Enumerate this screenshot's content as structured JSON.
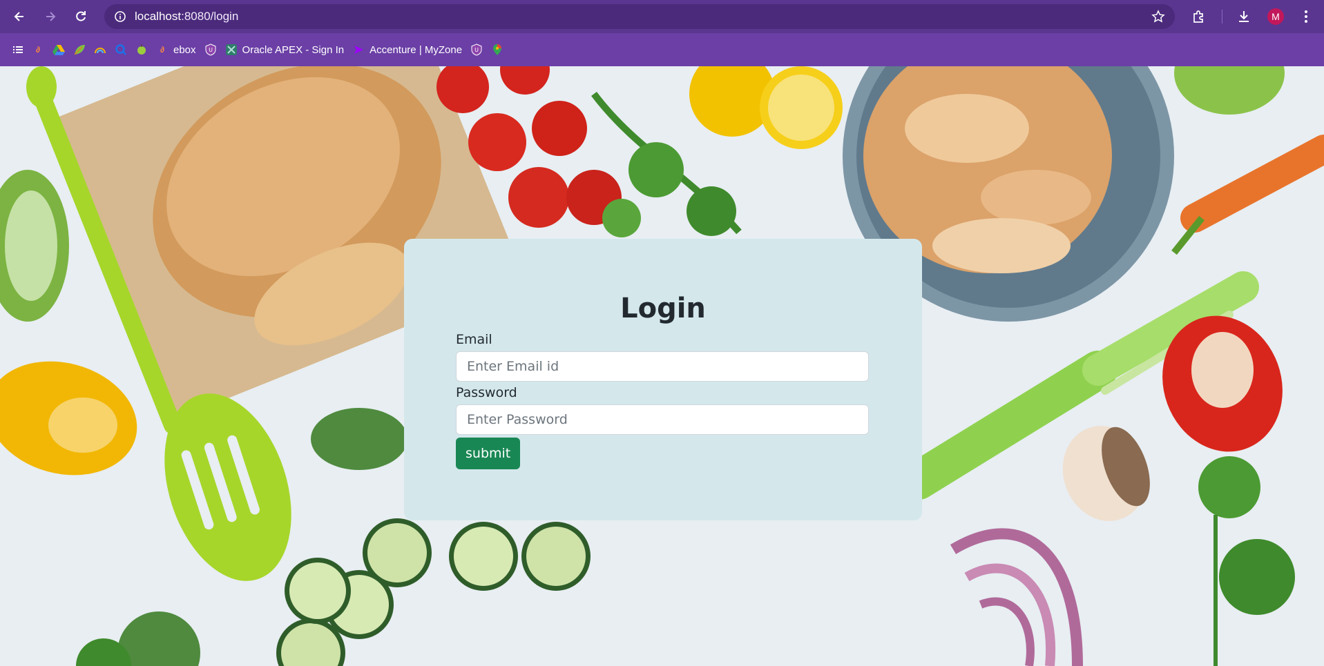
{
  "browser": {
    "url_host": "localhost",
    "url_path": ":8080/login",
    "avatar_letter": "M",
    "bookmarks": [
      {
        "icon": "apps-list-icon",
        "label": ""
      },
      {
        "icon": "link-icon",
        "label": ""
      },
      {
        "icon": "drive-icon",
        "label": ""
      },
      {
        "icon": "leaf-icon",
        "label": ""
      },
      {
        "icon": "rainbow-icon",
        "label": ""
      },
      {
        "icon": "search-icon",
        "label": ""
      },
      {
        "icon": "apple-icon",
        "label": ""
      },
      {
        "icon": "link-icon",
        "label": "ebox"
      },
      {
        "icon": "shield-icon",
        "label": ""
      },
      {
        "icon": "apex-icon",
        "label": "Oracle APEX - Sign In"
      },
      {
        "icon": "accenture-icon",
        "label": "Accenture | MyZone"
      },
      {
        "icon": "shield-icon",
        "label": ""
      },
      {
        "icon": "map-pin-icon",
        "label": ""
      }
    ]
  },
  "login": {
    "title": "Login",
    "email_label": "Email",
    "email_placeholder": "Enter Email id",
    "password_label": "Password",
    "password_placeholder": "Enter Password",
    "submit_label": "submit"
  },
  "colors": {
    "toolbar": "#5a3690",
    "bookmark_bar": "#6b3fa6",
    "card": "#d4e8ec",
    "submit": "#198754"
  }
}
